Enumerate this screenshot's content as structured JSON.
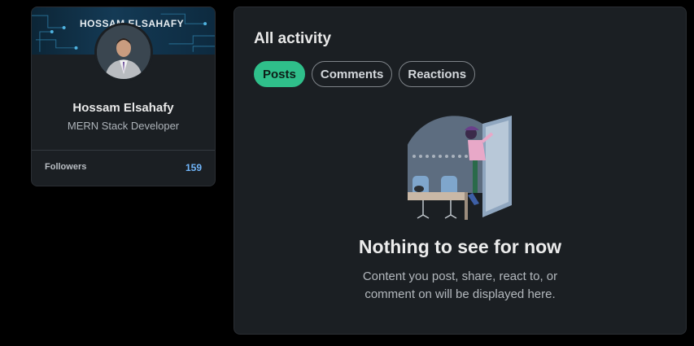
{
  "profile": {
    "banner_text": "HOSSAM ELSAHAFY",
    "name": "Hossam Elsahafy",
    "headline": "MERN Stack Developer",
    "followers_label": "Followers",
    "followers_count": "159"
  },
  "activity": {
    "title": "All activity",
    "tabs": [
      {
        "label": "Posts",
        "active": true
      },
      {
        "label": "Comments",
        "active": false
      },
      {
        "label": "Reactions",
        "active": false
      }
    ],
    "empty_title": "Nothing to see for now",
    "empty_desc_line1": "Content you post, share, react to, or",
    "empty_desc_line2": "comment on will be displayed here."
  },
  "colors": {
    "accent": "#2fbf8a",
    "followers_count": "#70b5f9",
    "card_bg": "#1b1f23"
  }
}
